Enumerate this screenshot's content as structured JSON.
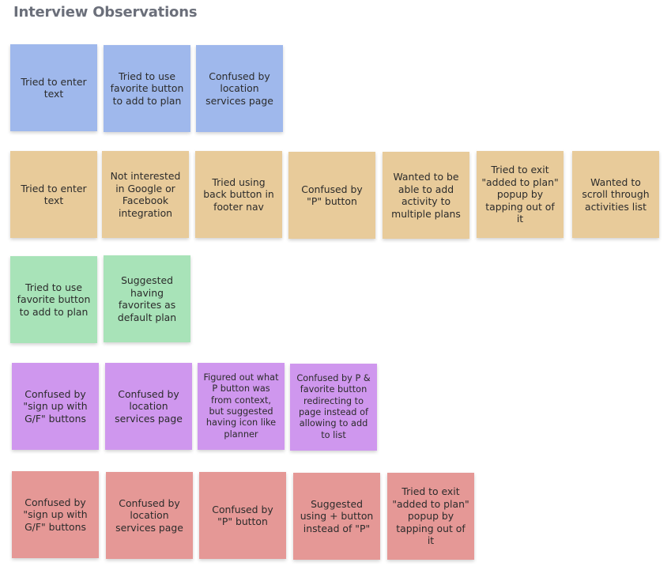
{
  "board": {
    "title": "Interview Observations"
  },
  "colors": {
    "blue": "#9fb8ec",
    "yellow": "#e8cb9a",
    "green": "#a8e3b8",
    "purple": "#cf97ee",
    "red": "#e59896"
  },
  "rows": {
    "blue": [
      "Tried to enter text",
      "Tried to use favorite button to add to plan",
      "Confused by location services page"
    ],
    "yellow": [
      "Tried to enter text",
      "Not interested in Google or Facebook integration",
      "Tried using back button in footer nav",
      "Confused by \"P\" button",
      "Wanted to be able to add activity to multiple plans",
      "Tried to exit \"added to plan\" popup by tapping out of it",
      "Wanted to scroll through activities list"
    ],
    "green": [
      "Tried to use favorite button to add to plan",
      "Suggested having favorites as default plan"
    ],
    "purple": [
      "Confused by \"sign up with G/F\" buttons",
      "Confused by location services page",
      "Figured out what P button was from context, but suggested having icon like planner",
      "Confused by P & favorite button redirecting to page instead of allowing to add to list"
    ],
    "red": [
      "Confused by \"sign up with G/F\" buttons",
      "Confused by location services page",
      "Confused by \"P\" button",
      "Suggested using + button instead of \"P\"",
      "Tried to exit \"added to plan\" popup by tapping out of it"
    ]
  }
}
